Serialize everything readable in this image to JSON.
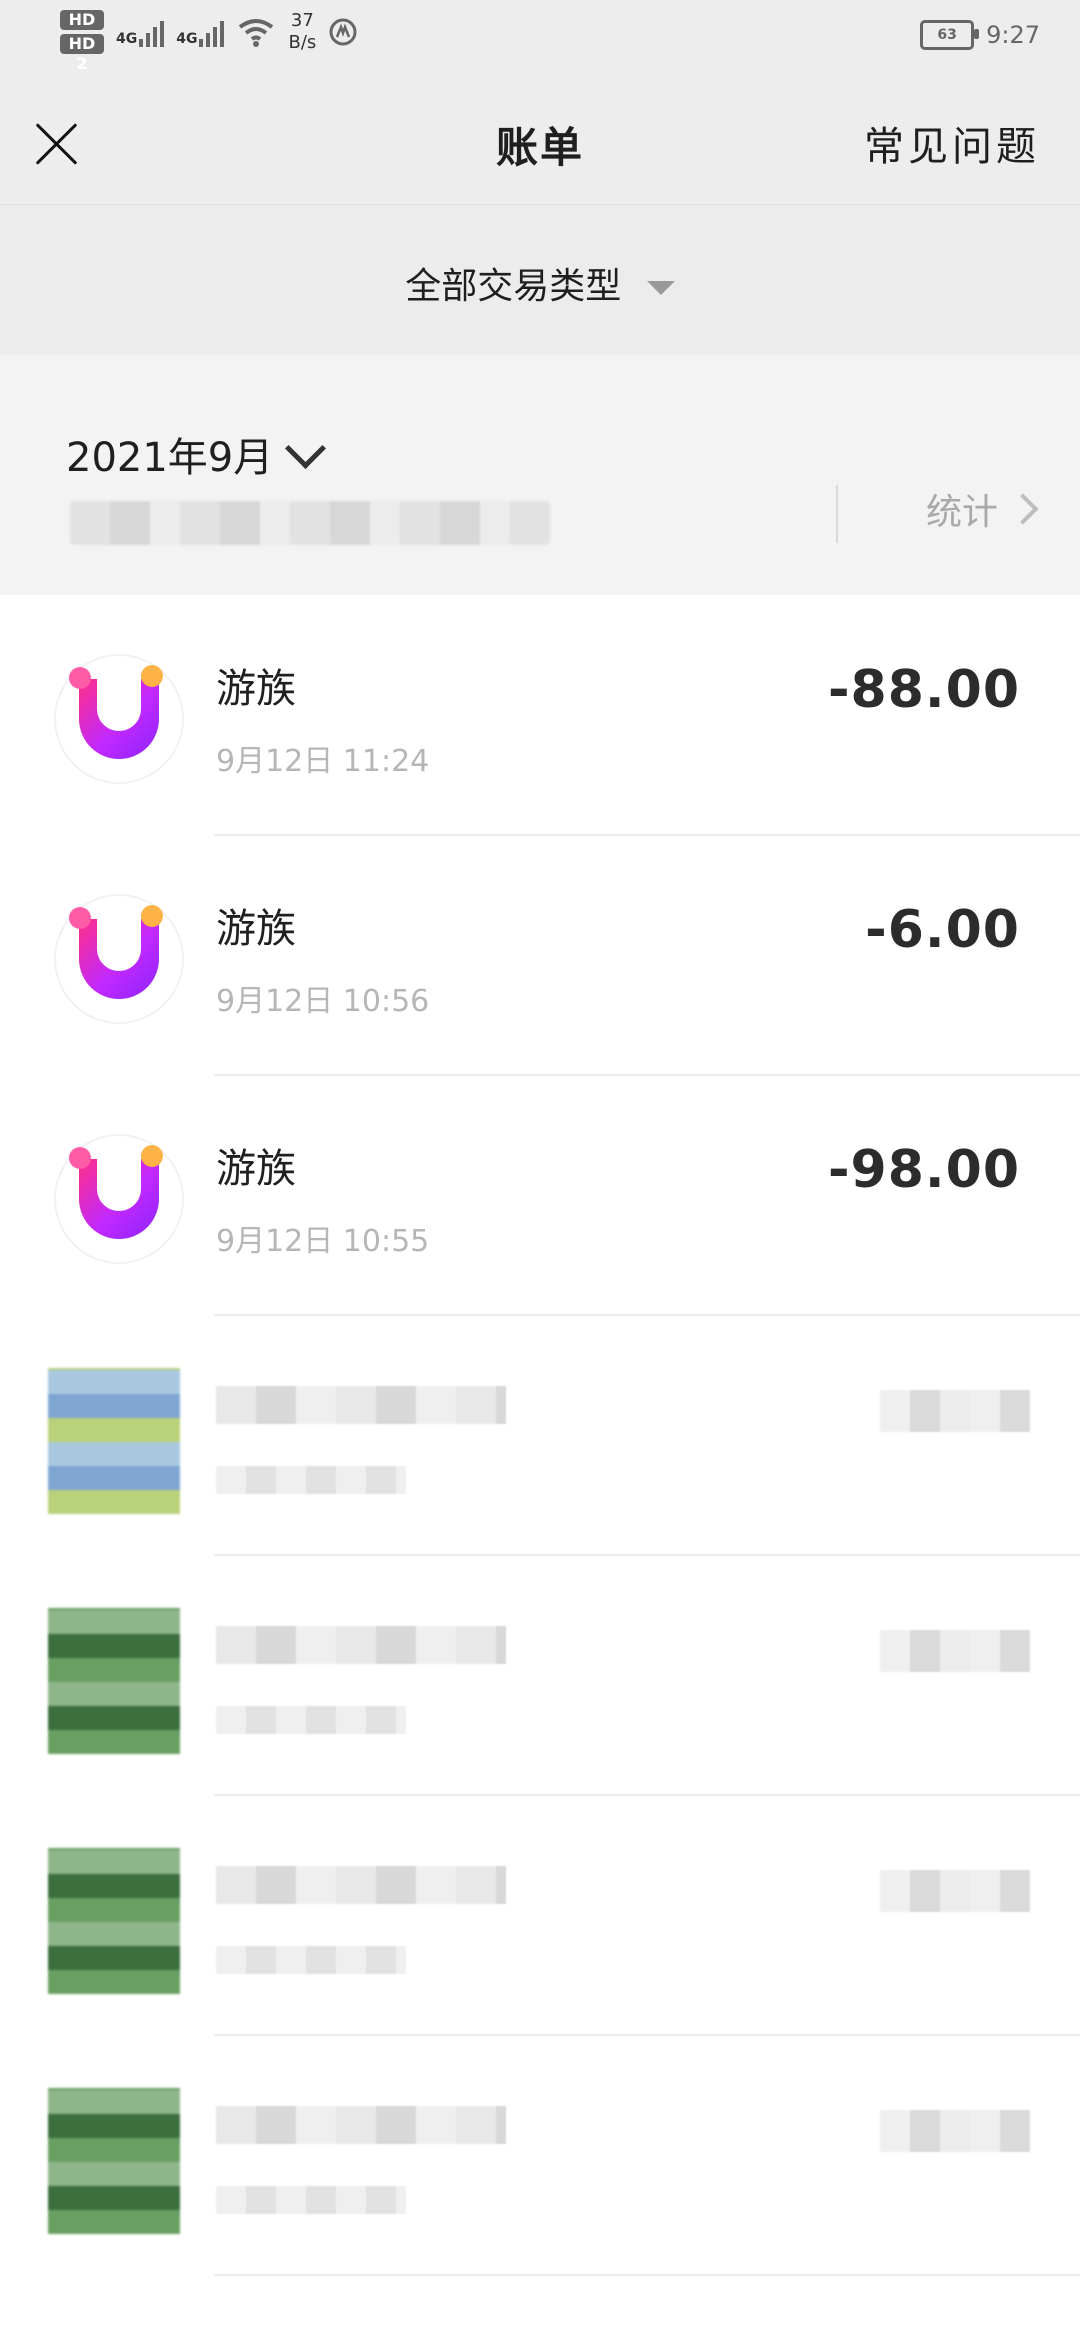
{
  "status_bar": {
    "sim1": "HD 1",
    "sim2": "HD 2",
    "network1": "4G",
    "network2": "4G",
    "speed_value": "37",
    "speed_unit": "B/s",
    "battery": "63",
    "time": "9:27"
  },
  "header": {
    "title": "账单",
    "faq_label": "常见问题",
    "close_icon": "close-icon"
  },
  "filter": {
    "label": "全部交易类型"
  },
  "month": {
    "label": "2021年9月",
    "stats_label": "统计"
  },
  "transactions": [
    {
      "merchant": "游族",
      "time": "9月12日 11:24",
      "amount": "-88.00"
    },
    {
      "merchant": "游族",
      "time": "9月12日 10:56",
      "amount": "-6.00"
    },
    {
      "merchant": "游族",
      "time": "9月12日 10:55",
      "amount": "-98.00"
    }
  ],
  "colors": {
    "header_bg": "#ededed",
    "list_bg": "#ffffff",
    "amount": "#2c2c2c",
    "muted": "#b6b6b6"
  }
}
